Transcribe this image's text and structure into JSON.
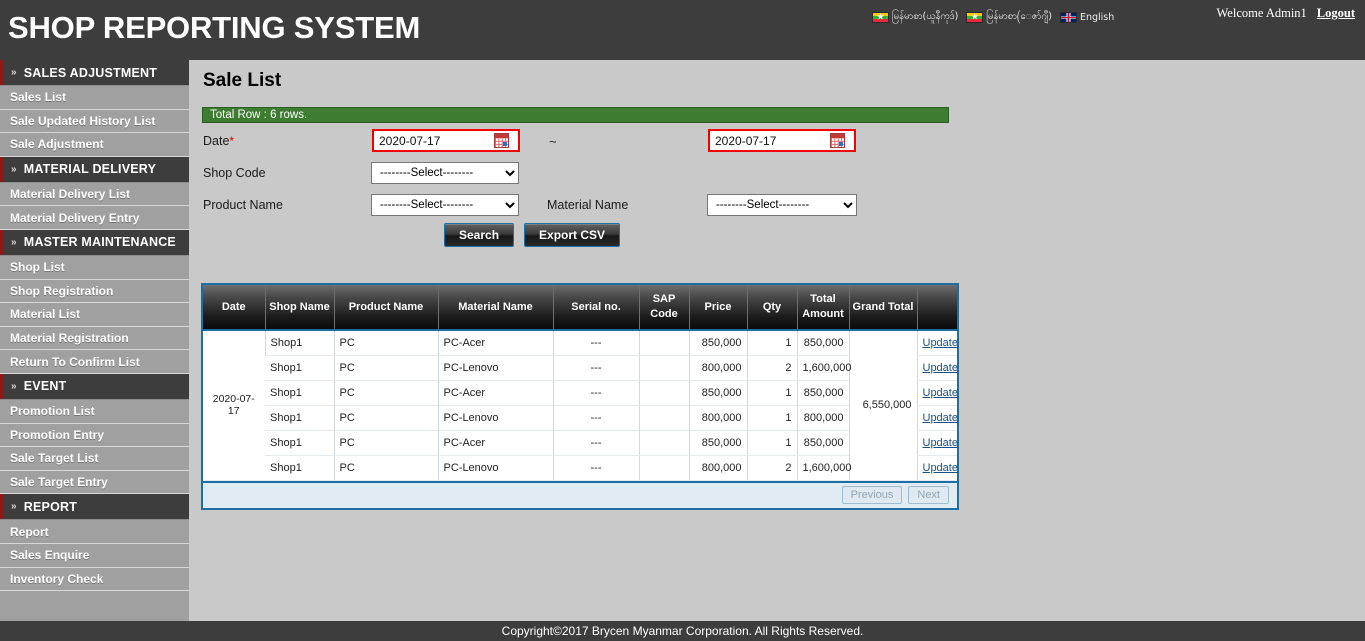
{
  "header": {
    "app_title": "SHOP REPORTING SYSTEM",
    "languages": [
      {
        "icon": "myanmar-flag-icon",
        "label": "မြန်မာစာ(ယူနီကုဒ်)"
      },
      {
        "icon": "myanmar-flag-icon",
        "label": "မြန်မာစာ(ေဇာ်ဂျီ)"
      },
      {
        "icon": "uk-flag-icon",
        "label": "English"
      }
    ],
    "welcome": "Welcome Admin1",
    "logout": "Logout"
  },
  "sidebar": {
    "groups": [
      {
        "title": "SALES ADJUSTMENT",
        "chevron": "»",
        "items": [
          "Sales List",
          "Sale Updated History List",
          "Sale Adjustment"
        ]
      },
      {
        "title": "MATERIAL DELIVERY",
        "chevron": "»",
        "items": [
          "Material Delivery List",
          "Material Delivery Entry"
        ]
      },
      {
        "title": "MASTER MAINTENANCE",
        "chevron": "»",
        "items": [
          "Shop List",
          "Shop Registration",
          "Material List",
          "Material Registration",
          "Return To Confirm List"
        ]
      },
      {
        "title": "EVENT",
        "chevron": "»",
        "items": [
          "Promotion List",
          "Promotion Entry",
          "Sale Target List",
          "Sale Target Entry"
        ]
      },
      {
        "title": "REPORT",
        "chevron": "»",
        "items": [
          "Report",
          "Sales Enquire",
          "Inventory Check"
        ]
      }
    ]
  },
  "main": {
    "page_title": "Sale List",
    "total_row_banner": "Total Row : 6 rows.",
    "form": {
      "date_label": "Date",
      "date_required_mark": "*",
      "date_from": "2020-07-17",
      "date_to": "2020-07-17",
      "date_separator": "~",
      "shop_code_label": "Shop Code",
      "shop_code_value": "--------Select--------",
      "product_name_label": "Product Name",
      "product_name_value": "--------Select--------",
      "material_name_label": "Material Name",
      "material_name_value": "--------Select--------",
      "search_button": "Search",
      "export_button": "Export CSV"
    },
    "table": {
      "columns": [
        "Date",
        "Shop Name",
        "Product Name",
        "Material Name",
        "Serial no.",
        "SAP Code",
        "Price",
        "Qty",
        "Total Amount",
        "Grand Total",
        ""
      ],
      "date": "2020-07-17",
      "grand_total": "6,550,000",
      "rows": [
        {
          "shop": "Shop1",
          "product": "PC",
          "material": "PC-Acer",
          "serial": "---",
          "sap": "",
          "price": "850,000",
          "qty": "1",
          "total": "850,000",
          "action": "Update"
        },
        {
          "shop": "Shop1",
          "product": "PC",
          "material": "PC-Lenovo",
          "serial": "---",
          "sap": "",
          "price": "800,000",
          "qty": "2",
          "total": "1,600,000",
          "action": "Update"
        },
        {
          "shop": "Shop1",
          "product": "PC",
          "material": "PC-Acer",
          "serial": "---",
          "sap": "",
          "price": "850,000",
          "qty": "1",
          "total": "850,000",
          "action": "Update"
        },
        {
          "shop": "Shop1",
          "product": "PC",
          "material": "PC-Lenovo",
          "serial": "---",
          "sap": "",
          "price": "800,000",
          "qty": "1",
          "total": "800,000",
          "action": "Update"
        },
        {
          "shop": "Shop1",
          "product": "PC",
          "material": "PC-Acer",
          "serial": "---",
          "sap": "",
          "price": "850,000",
          "qty": "1",
          "total": "850,000",
          "action": "Update"
        },
        {
          "shop": "Shop1",
          "product": "PC",
          "material": "PC-Lenovo",
          "serial": "---",
          "sap": "",
          "price": "800,000",
          "qty": "2",
          "total": "1,600,000",
          "action": "Update"
        }
      ],
      "pager": {
        "previous": "Previous",
        "next": "Next"
      }
    }
  },
  "footer": {
    "copyright": "Copyright©2017 Brycen Myanmar Corporation. All Rights Reserved."
  },
  "colors": {
    "header_bg": "#3d3d3d",
    "sidebar_bg": "#a0a0a0",
    "accent_red": "#8b1a1a",
    "banner_green": "#3d7c31",
    "table_border_blue": "#1c6ea4",
    "pager_bg": "#e1ecf2",
    "date_border_red": "#f40000",
    "link_blue": "#1a4f8a"
  }
}
